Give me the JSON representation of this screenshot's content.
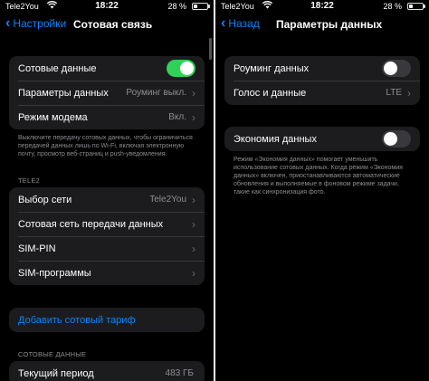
{
  "left": {
    "status": {
      "carrier": "Tele2You",
      "time": "18:22",
      "battery": "28 %"
    },
    "back_label": "Настройки",
    "title": "Сотовая связь",
    "main_group": [
      {
        "label": "Сотовые данные",
        "toggle": "on"
      },
      {
        "label": "Параметры данных",
        "value": "Роуминг выкл."
      },
      {
        "label": "Режим модема",
        "value": "Вкл."
      }
    ],
    "main_footnote": "Выключите передачу сотовых данных, чтобы ограничиться передачей данных лишь по Wi-Fi, включая электронную почту, просмотр веб-страниц и push-уведомления.",
    "carrier_header": "TELE2",
    "carrier_group": [
      {
        "label": "Выбор сети",
        "value": "Tele2You"
      },
      {
        "label": "Сотовая сеть передачи данных"
      },
      {
        "label": "SIM-PIN"
      },
      {
        "label": "SIM-программы"
      }
    ],
    "add_plan": "Добавить сотовый тариф",
    "data_header": "СОТОВЫЕ ДАННЫЕ",
    "data_group": [
      {
        "label": "Текущий период",
        "value": "483 ГБ"
      }
    ]
  },
  "right": {
    "status": {
      "carrier": "Tele2You",
      "time": "18:22",
      "battery": "28 %"
    },
    "back_label": "Назад",
    "title": "Параметры данных",
    "main_group": [
      {
        "label": "Роуминг данных",
        "toggle": "off"
      },
      {
        "label": "Голос и данные",
        "value": "LTE"
      }
    ],
    "economy_group": [
      {
        "label": "Экономия данных",
        "toggle": "off"
      }
    ],
    "economy_footnote": "Режим «Экономия данных» помогает уменьшить использование сотовых данных. Когда режим «Экономия данных» включен, приостанавливаются автоматические обновления и выполняемые в фоновом режиме задачи, такие как синхронизация фото."
  },
  "colors": {
    "accent": "#0a84ff",
    "toggle_on": "#30d158",
    "cell_bg": "#1c1c1e"
  }
}
